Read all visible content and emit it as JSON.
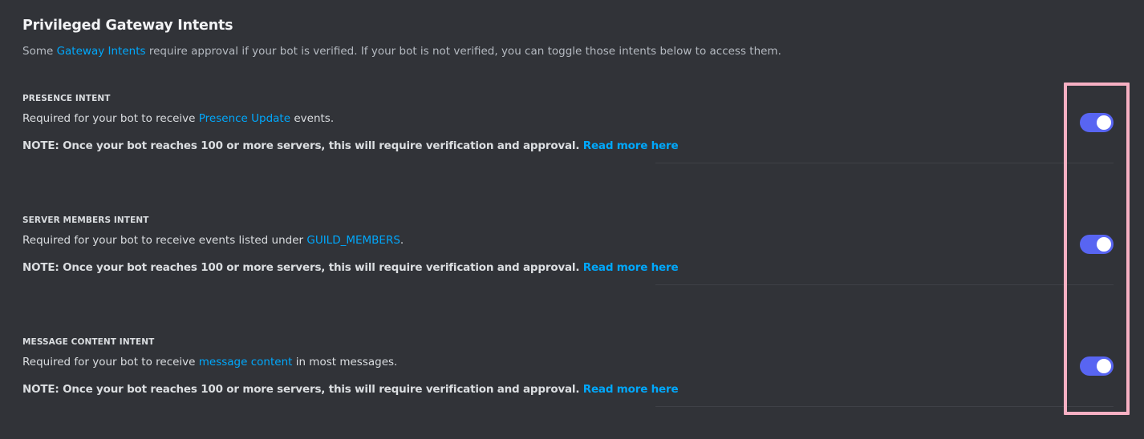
{
  "section": {
    "title": "Privileged Gateway Intents",
    "subtitle_prefix": "Some ",
    "subtitle_link": "Gateway Intents",
    "subtitle_suffix": " require approval if your bot is verified. If your bot is not verified, you can toggle those intents below to access them."
  },
  "intents": [
    {
      "heading": "PRESENCE INTENT",
      "desc_prefix": "Required for your bot to receive ",
      "desc_link": "Presence Update",
      "desc_suffix": " events.",
      "note": "NOTE: Once your bot reaches 100 or more servers, this will require verification and approval.",
      "note_link": "Read more here",
      "enabled": true
    },
    {
      "heading": "SERVER MEMBERS INTENT",
      "desc_prefix": "Required for your bot to receive events listed under ",
      "desc_link": "GUILD_MEMBERS",
      "desc_suffix": ".",
      "note": "NOTE: Once your bot reaches 100 or more servers, this will require verification and approval.",
      "note_link": "Read more here",
      "enabled": true
    },
    {
      "heading": "MESSAGE CONTENT INTENT",
      "desc_prefix": "Required for your bot to receive ",
      "desc_link": "message content",
      "desc_suffix": " in most messages.",
      "note": "NOTE: Once your bot reaches 100 or more servers, this will require verification and approval.",
      "note_link": "Read more here",
      "enabled": true
    }
  ],
  "colors": {
    "background": "#313338",
    "link": "#00a8fc",
    "toggle_on": "#5865f2",
    "highlight": "#f7b0c3"
  }
}
